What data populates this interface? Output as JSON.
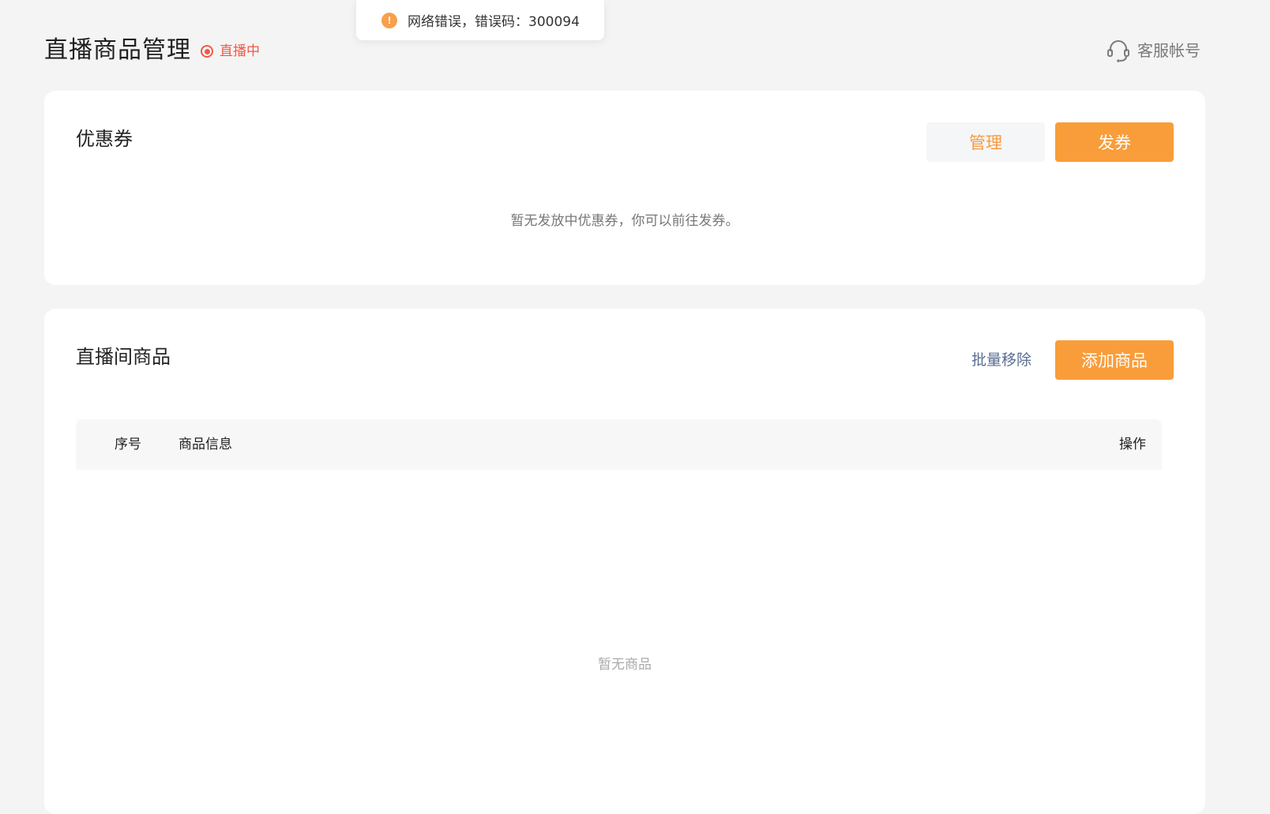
{
  "toast": {
    "icon": "warning-icon",
    "message": "网络错误，错误码：300094",
    "color": "#f8a04a"
  },
  "header": {
    "title": "直播商品管理",
    "live_status": "直播中",
    "live_color": "#f05a47",
    "service_label": "客服帐号",
    "service_icon": "headset-icon"
  },
  "coupon": {
    "title": "优惠券",
    "manage_label": "管理",
    "issue_label": "发券",
    "empty_text": "暂无发放中优惠券，你可以前往发券。"
  },
  "goods": {
    "title": "直播间商品",
    "batch_remove_label": "批量移除",
    "add_label": "添加商品",
    "columns": {
      "index": "序号",
      "info": "商品信息",
      "action": "操作"
    },
    "empty_text": "暂无商品"
  },
  "colors": {
    "accent": "#f99d3a",
    "background": "#f4f4f4",
    "link": "#5a6e91"
  }
}
